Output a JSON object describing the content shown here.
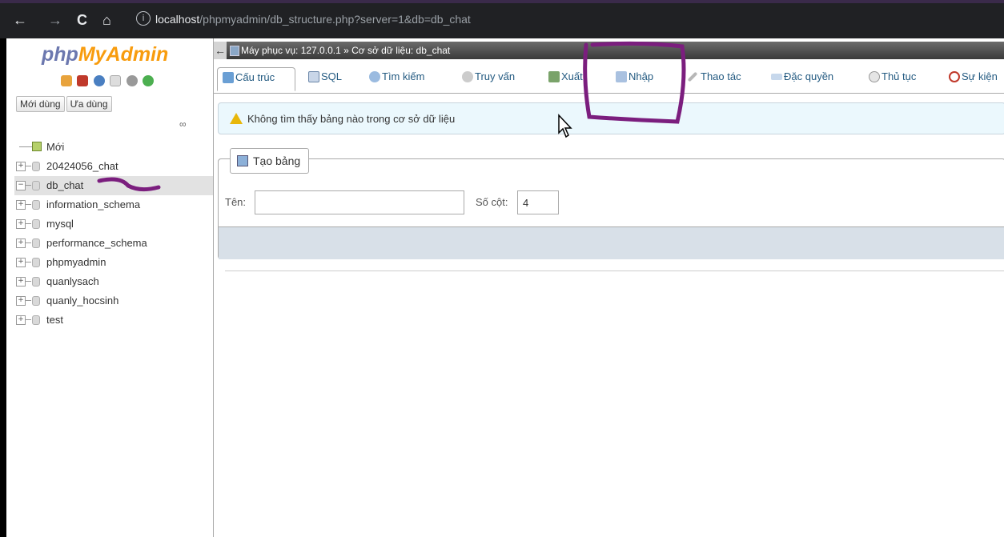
{
  "browser": {
    "url_host": "localhost",
    "url_path": "/phpmyadmin/db_structure.php?server=1&db=db_chat",
    "back": "←",
    "forward": "→",
    "reload": "C",
    "home": "⌂",
    "info": "i"
  },
  "sidebar": {
    "logo_php": "php",
    "logo_myadmin": "MyAdmin",
    "recent_label": "Mới dùng",
    "favorite_label": "Ưa dùng",
    "link_icon": "∞",
    "new_label": "Mới",
    "databases": [
      {
        "name": "20424056_chat",
        "expander": "+"
      },
      {
        "name": "db_chat",
        "expander": "−"
      },
      {
        "name": "information_schema",
        "expander": "+"
      },
      {
        "name": "mysql",
        "expander": "+"
      },
      {
        "name": "performance_schema",
        "expander": "+"
      },
      {
        "name": "phpmyadmin",
        "expander": "+"
      },
      {
        "name": "quanlysach",
        "expander": "+"
      },
      {
        "name": "quanly_hocsinh",
        "expander": "+"
      },
      {
        "name": "test",
        "expander": "+"
      }
    ]
  },
  "main": {
    "collapse_arrow": "←",
    "breadcrumb": "Máy phục vụ: 127.0.0.1 » Cơ sở dữ liệu: db_chat",
    "tabs": [
      {
        "label": "Cấu trúc"
      },
      {
        "label": "SQL"
      },
      {
        "label": "Tìm kiếm"
      },
      {
        "label": "Truy vấn"
      },
      {
        "label": "Xuất"
      },
      {
        "label": "Nhập"
      },
      {
        "label": "Thao tác"
      },
      {
        "label": "Đặc quyền"
      },
      {
        "label": "Thủ tục"
      },
      {
        "label": "Sự kiện"
      }
    ],
    "message": "Không tìm thấy bảng nào trong cơ sở dữ liệu",
    "create_table": {
      "legend": "Tạo bảng",
      "name_label": "Tên:",
      "name_value": "",
      "columns_label": "Số cột:",
      "columns_value": "4"
    }
  },
  "colors": {
    "annotation": "#7b1e7e",
    "logo_blue": "#6c78af",
    "logo_orange": "#f89c0e",
    "link": "#235a81"
  }
}
